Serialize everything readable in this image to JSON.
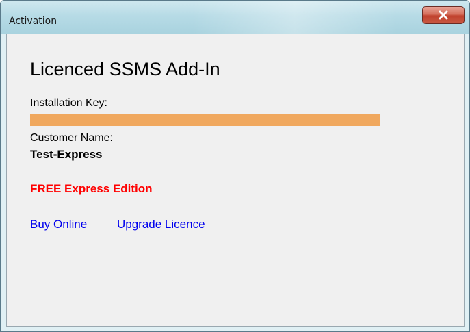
{
  "window": {
    "title": "Activation",
    "close_icon": "close-x-icon"
  },
  "main": {
    "heading": "Licenced SSMS Add-In",
    "installation_key_label": "Installation Key:",
    "installation_key_value": "",
    "installation_key_bar_color": "#f0a85e",
    "customer_name_label": "Customer Name:",
    "customer_name_value": "Test-Express",
    "edition_text": "FREE Express Edition",
    "edition_color": "#ff0000",
    "links": {
      "buy_online": "Buy Online",
      "upgrade_licence": "Upgrade Licence"
    }
  }
}
